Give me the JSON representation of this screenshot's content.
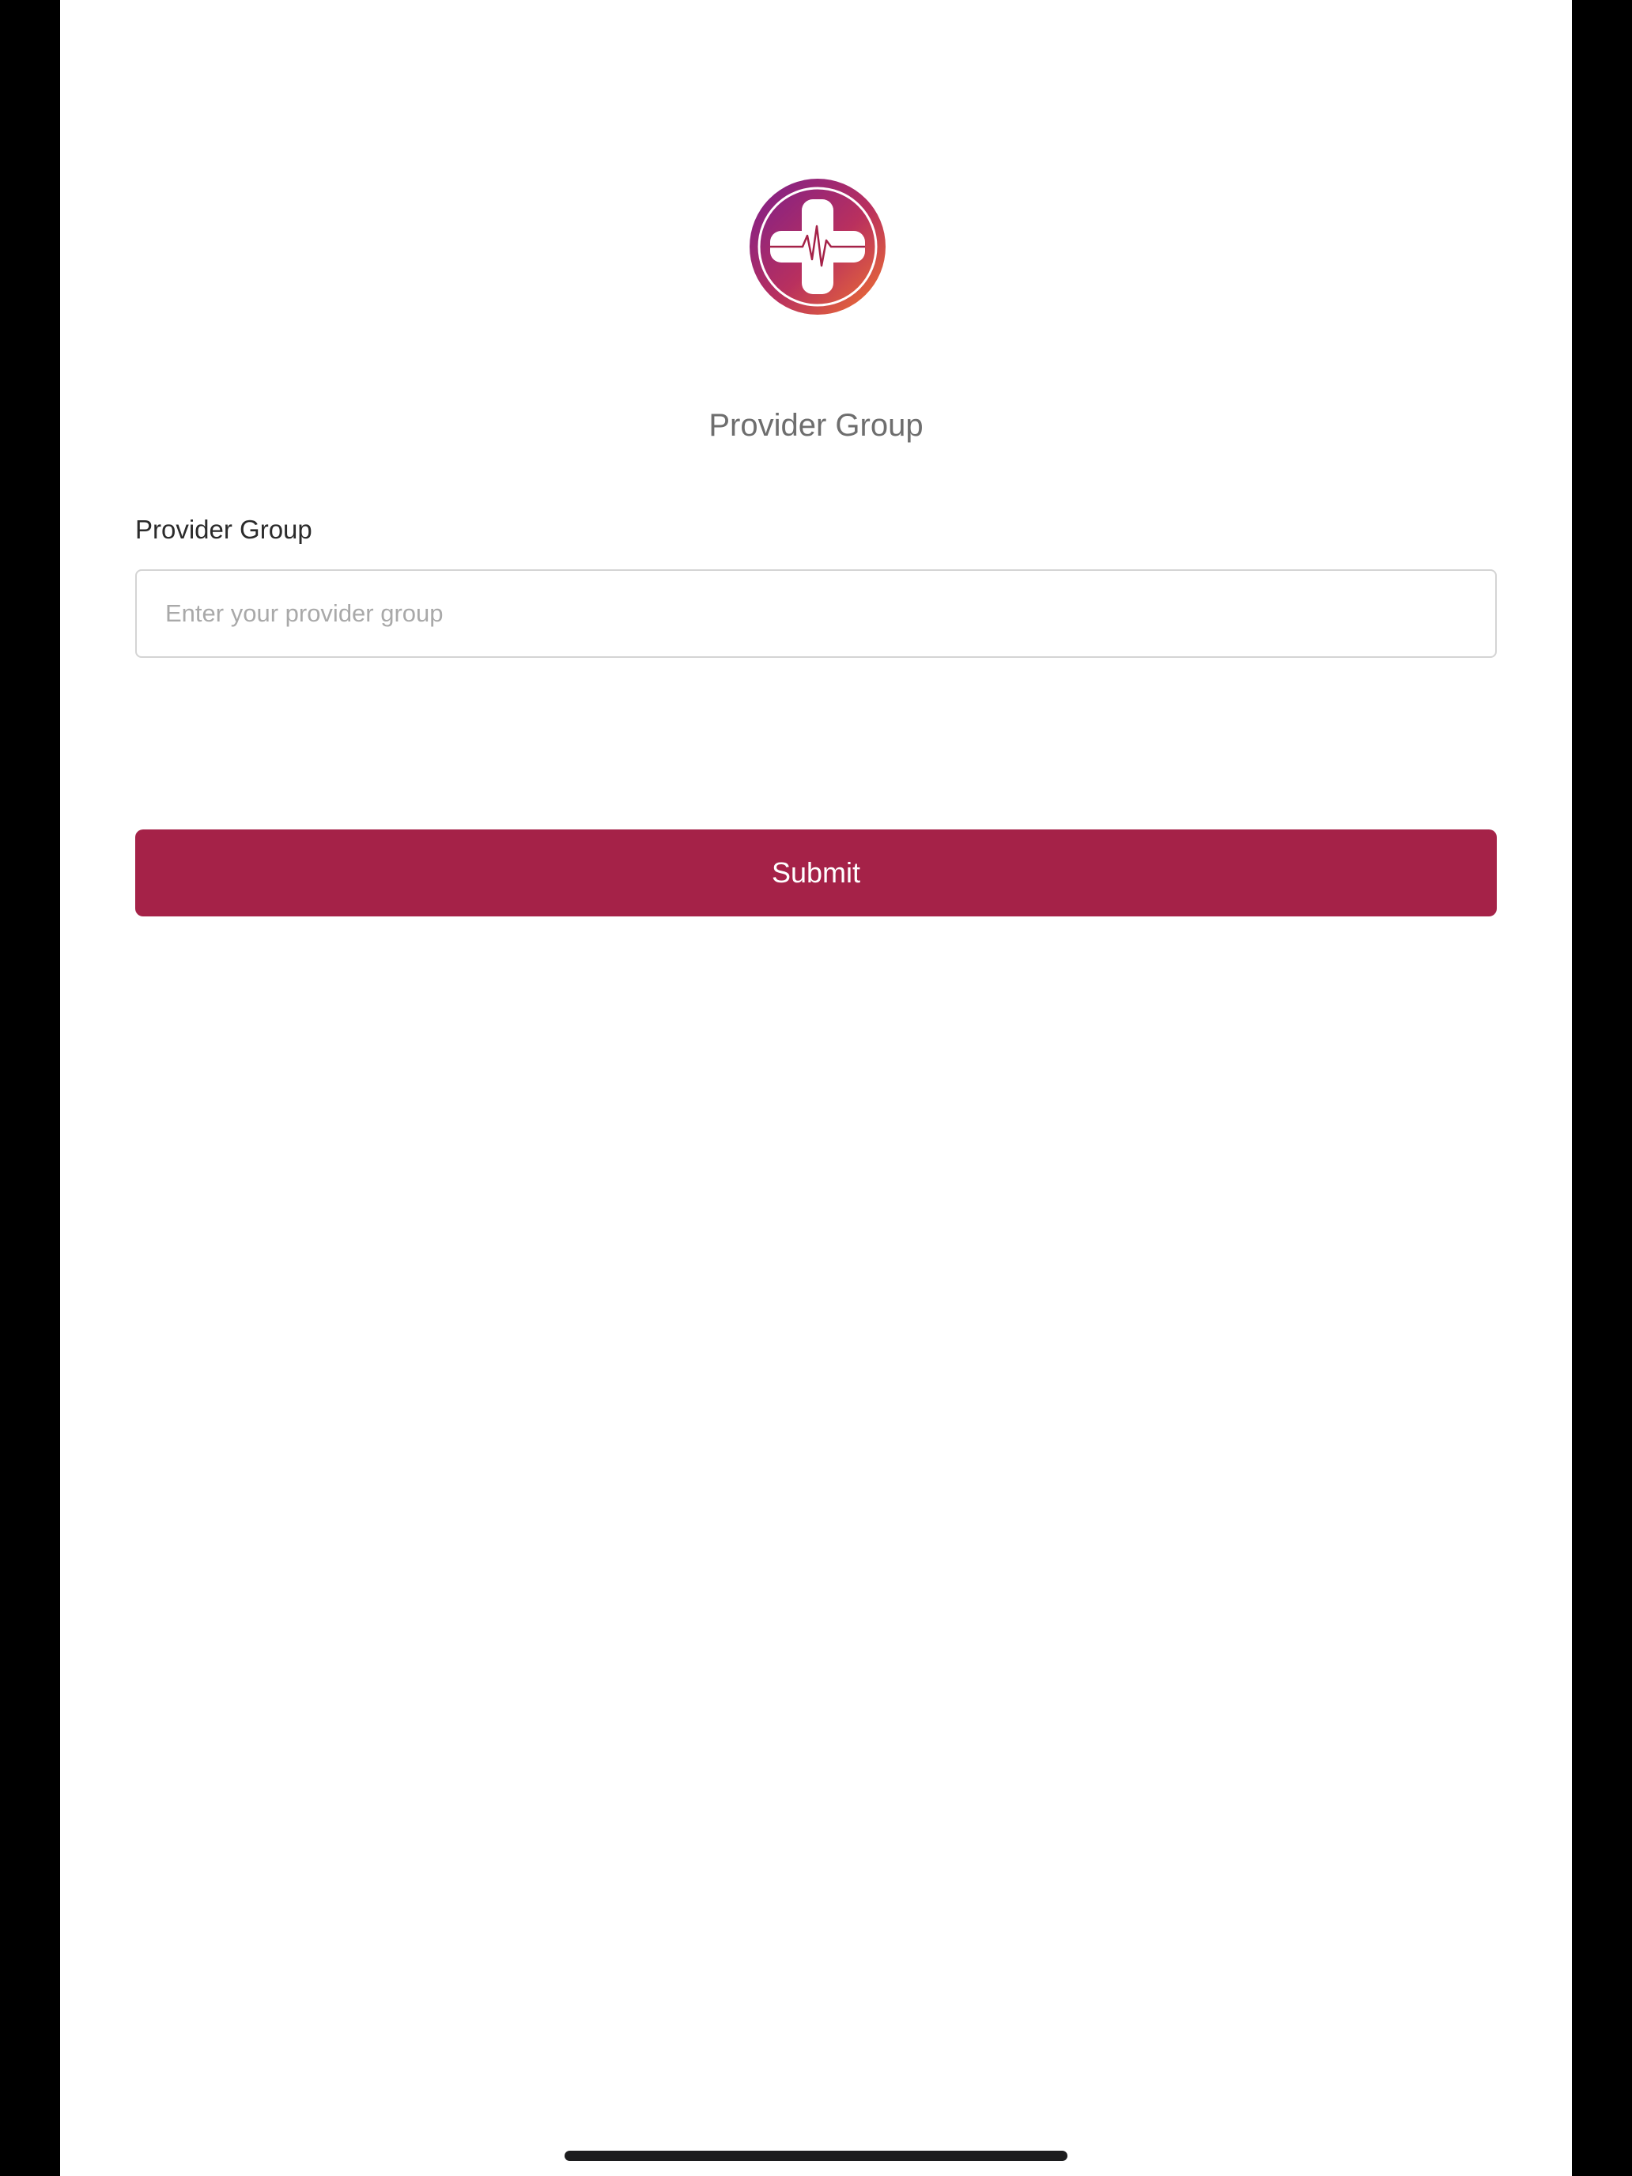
{
  "app": {
    "logo_icon": "medical-cross-heartbeat-icon",
    "title": "Provider Group"
  },
  "form": {
    "field_label": "Provider Group",
    "field_value": "",
    "field_placeholder": "Enter your provider group",
    "submit_label": "Submit"
  },
  "colors": {
    "accent": "#a52248",
    "logo_gradient_start": "#7b1e8c",
    "logo_gradient_end": "#f2762e"
  }
}
